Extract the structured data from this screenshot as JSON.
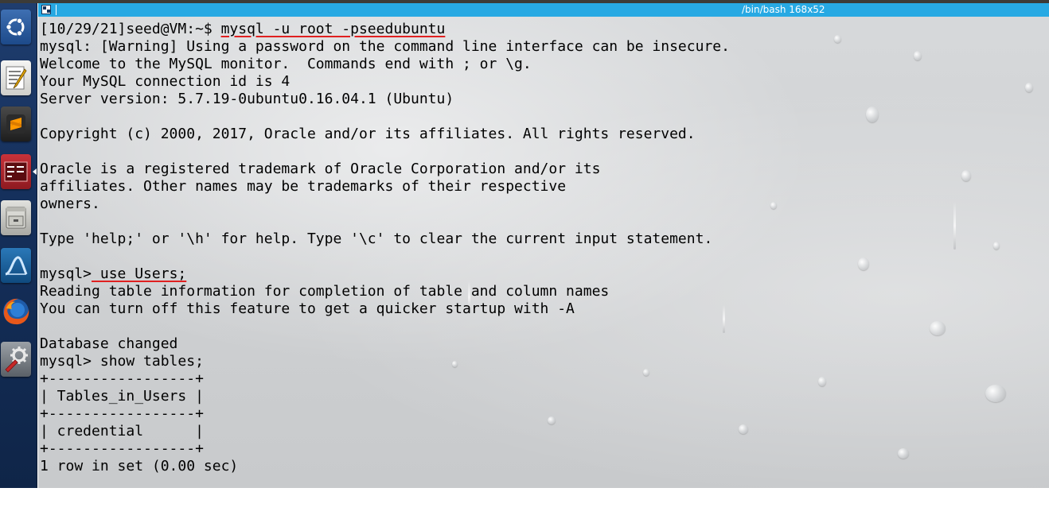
{
  "window": {
    "title": "/bin/bash 168x52"
  },
  "launcher": {
    "items": [
      {
        "name": "ubuntu-dash",
        "icon": "ubuntu-logo-icon"
      },
      {
        "name": "text-editor",
        "icon": "text-editor-icon"
      },
      {
        "name": "sublime-text",
        "icon": "sublime-text-icon"
      },
      {
        "name": "terminal",
        "icon": "terminal-icon",
        "active": true
      },
      {
        "name": "files",
        "icon": "file-cabinet-icon"
      },
      {
        "name": "wireshark",
        "icon": "wireshark-icon"
      },
      {
        "name": "firefox",
        "icon": "firefox-icon"
      },
      {
        "name": "system-settings",
        "icon": "settings-icon"
      }
    ]
  },
  "terminal": {
    "lines": [
      {
        "prompt": "[10/29/21]seed@VM:~$ ",
        "command": "mysql -u root -pseedubuntu"
      },
      {
        "text": "mysql: [Warning] Using a password on the command line interface can be insecure."
      },
      {
        "text": "Welcome to the MySQL monitor.  Commands end with ; or \\g."
      },
      {
        "text": "Your MySQL connection id is 4"
      },
      {
        "text": "Server version: 5.7.19-0ubuntu0.16.04.1 (Ubuntu)"
      },
      {
        "text": ""
      },
      {
        "text": "Copyright (c) 2000, 2017, Oracle and/or its affiliates. All rights reserved."
      },
      {
        "text": ""
      },
      {
        "text": "Oracle is a registered trademark of Oracle Corporation and/or its"
      },
      {
        "text": "affiliates. Other names may be trademarks of their respective"
      },
      {
        "text": "owners."
      },
      {
        "text": ""
      },
      {
        "text": "Type 'help;' or '\\h' for help. Type '\\c' to clear the current input statement."
      },
      {
        "text": ""
      },
      {
        "prompt": "mysql>",
        "command": " use Users;"
      },
      {
        "text": "Reading table information for completion of table and column names"
      },
      {
        "text": "You can turn off this feature to get a quicker startup with -A"
      },
      {
        "text": ""
      },
      {
        "text": "Database changed"
      },
      {
        "text": "mysql> show tables;"
      },
      {
        "text": "+-----------------+"
      },
      {
        "text": "| Tables_in_Users |"
      },
      {
        "text": "+-----------------+"
      },
      {
        "text": "| credential      |"
      },
      {
        "text": "+-----------------+"
      },
      {
        "text": "1 row in set (0.00 sec)"
      }
    ]
  },
  "colors": {
    "launcher_bg": "#15305c",
    "titlebar_bg": "#27a9e3",
    "terminal_text": "#000000",
    "command_underline": "#e02020"
  }
}
